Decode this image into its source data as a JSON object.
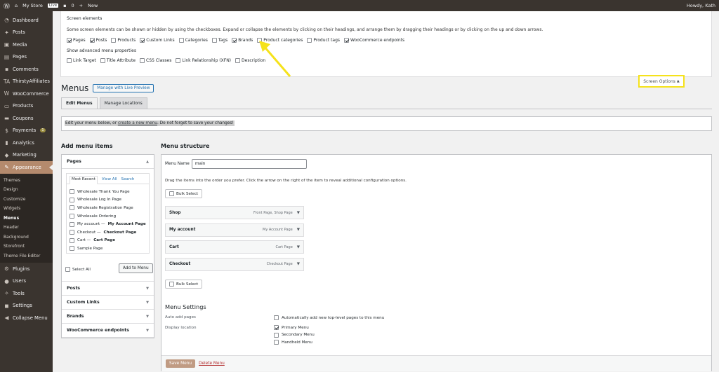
{
  "adminbar": {
    "site": "My Store",
    "live": "Live",
    "comments": "0",
    "new": "New",
    "howdy": "Howdy, Kath"
  },
  "sidebar": {
    "items_top": [
      {
        "label": "Dashboard",
        "icon": "dashboard-icon"
      },
      {
        "label": "Posts",
        "icon": "pin-icon"
      },
      {
        "label": "Media",
        "icon": "media-icon"
      },
      {
        "label": "Pages",
        "icon": "page-icon"
      },
      {
        "label": "Comments",
        "icon": "comment-icon"
      },
      {
        "label": "ThirstyAffiliates",
        "icon": "ta-icon"
      },
      {
        "label": "WooCommerce",
        "icon": "woo-icon"
      },
      {
        "label": "Products",
        "icon": "products-icon"
      },
      {
        "label": "Coupons",
        "icon": "coupons-icon"
      },
      {
        "label": "Payments",
        "icon": "payments-icon",
        "badge": "1"
      },
      {
        "label": "Analytics",
        "icon": "analytics-icon"
      },
      {
        "label": "Marketing",
        "icon": "marketing-icon"
      }
    ],
    "appearance": "Appearance",
    "submenu": [
      "Themes",
      "Design",
      "Customize",
      "Widgets",
      "Menus",
      "Header",
      "Background",
      "Storefront",
      "Theme File Editor"
    ],
    "items_bottom": [
      {
        "label": "Plugins",
        "icon": "plugins-icon"
      },
      {
        "label": "Users",
        "icon": "users-icon"
      },
      {
        "label": "Tools",
        "icon": "tools-icon"
      },
      {
        "label": "Settings",
        "icon": "settings-icon"
      },
      {
        "label": "Collapse Menu",
        "icon": "collapse-icon"
      }
    ]
  },
  "screen_options": {
    "heading": "Screen elements",
    "description": "Some screen elements can be shown or hidden by using the checkboxes. Expand or collapse the elements by clicking on their headings, and arrange them by dragging their headings or by clicking on the up and down arrows.",
    "elements": [
      {
        "label": "Pages",
        "checked": true
      },
      {
        "label": "Posts",
        "checked": true
      },
      {
        "label": "Products",
        "checked": false
      },
      {
        "label": "Custom Links",
        "checked": true
      },
      {
        "label": "Categories",
        "checked": false
      },
      {
        "label": "Tags",
        "checked": false
      },
      {
        "label": "Brands",
        "checked": true
      },
      {
        "label": "Product categories",
        "checked": false
      },
      {
        "label": "Product tags",
        "checked": false
      },
      {
        "label": "WooCommerce endpoints",
        "checked": true
      }
    ],
    "advanced_heading": "Show advanced menu properties",
    "advanced": [
      {
        "label": "Link Target",
        "checked": false
      },
      {
        "label": "Title Attribute",
        "checked": false
      },
      {
        "label": "CSS Classes",
        "checked": false
      },
      {
        "label": "Link Relationship (XFN)",
        "checked": false
      },
      {
        "label": "Description",
        "checked": false
      }
    ],
    "toggle_label": "Screen Options"
  },
  "page": {
    "title": "Menus",
    "live_preview": "Manage with Live Preview",
    "tab_edit": "Edit Menus",
    "tab_locations": "Manage Locations",
    "notice_pre": "Edit your menu below, or ",
    "notice_link": "create a new menu",
    "notice_post": ". Do not forget to save your changes!"
  },
  "add_menu_items": {
    "title": "Add menu items",
    "pages_label": "Pages",
    "tabs": [
      "Most Recent",
      "View All",
      "Search"
    ],
    "pages": [
      {
        "label": "Wholesale Thank You Page",
        "bold": ""
      },
      {
        "label": "Wholesale Log In Page",
        "bold": ""
      },
      {
        "label": "Wholesale Registration Page",
        "bold": ""
      },
      {
        "label": "Wholesale Ordering",
        "bold": ""
      },
      {
        "label": "My account — ",
        "bold": "My Account Page"
      },
      {
        "label": "Checkout — ",
        "bold": "Checkout Page"
      },
      {
        "label": "Cart — ",
        "bold": "Cart Page"
      },
      {
        "label": "Sample Page",
        "bold": ""
      }
    ],
    "select_all": "Select All",
    "add_button": "Add to Menu",
    "accordions": [
      "Posts",
      "Custom Links",
      "Brands",
      "WooCommerce endpoints"
    ]
  },
  "menu_structure": {
    "title": "Menu structure",
    "name_label": "Menu Name",
    "name_value": "main",
    "instructions": "Drag the items into the order you prefer. Click the arrow on the right of the item to reveal additional configuration options.",
    "bulk_select": "Bulk Select",
    "items": [
      {
        "title": "Shop",
        "type": "Front Page, Shop Page"
      },
      {
        "title": "My account",
        "type": "My Account Page"
      },
      {
        "title": "Cart",
        "type": "Cart Page"
      },
      {
        "title": "Checkout",
        "type": "Checkout Page"
      }
    ],
    "settings_title": "Menu Settings",
    "auto_add_label": "Auto add pages",
    "auto_add_option": "Automatically add new top-level pages to this menu",
    "display_label": "Display location",
    "locations": [
      {
        "label": "Primary Menu",
        "checked": true
      },
      {
        "label": "Secondary Menu",
        "checked": false
      },
      {
        "label": "Handheld Menu",
        "checked": false
      }
    ],
    "save": "Save Menu",
    "delete": "Delete Menu"
  }
}
